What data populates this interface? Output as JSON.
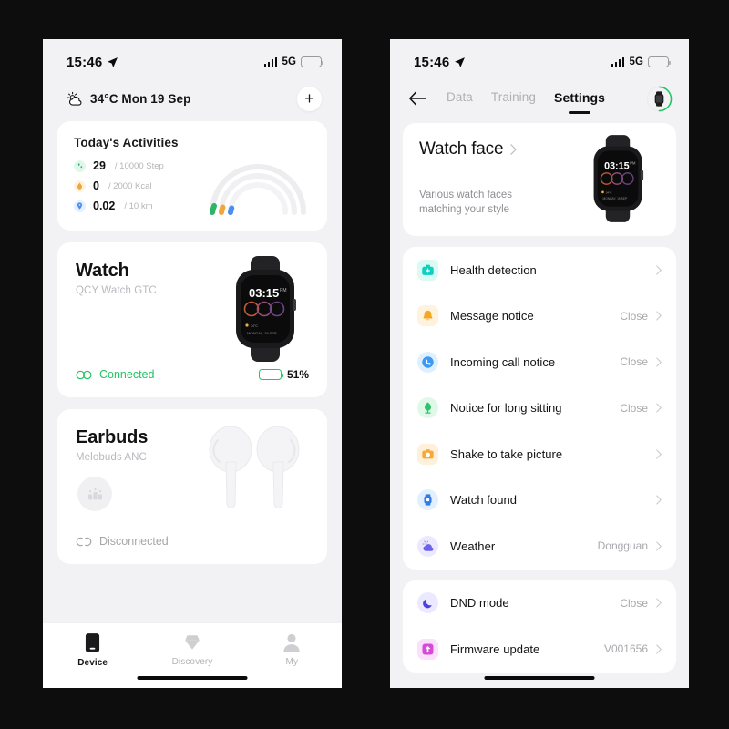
{
  "theme": {
    "background": "#0d0d0d",
    "phone_bg": "#f2f2f4",
    "card_bg": "#ffffff",
    "accent_green": "#22c563",
    "muted": "#b4b4b8"
  },
  "left_phone": {
    "status_bar": {
      "time": "15:46",
      "location_icon": "location-arrow-icon",
      "signal_icon": "signal-bars-icon",
      "network": "5G",
      "battery_icon": "battery-icon"
    },
    "weather": {
      "icon": "sun-cloud-icon",
      "text": "34°C Mon 19 Sep",
      "add_button": "+"
    },
    "activities": {
      "title": "Today's Activities",
      "rows": [
        {
          "icon": "steps-icon",
          "value": "29",
          "goal": "/ 10000 Step"
        },
        {
          "icon": "flame-icon",
          "value": "0",
          "goal": "/ 2000 Kcal"
        },
        {
          "icon": "location-pin-icon",
          "value": "0.02",
          "goal": "/ 10 km"
        }
      ],
      "arc_colors": [
        "#2db566",
        "#f0a63c",
        "#4a8ef0"
      ]
    },
    "watch_card": {
      "name": "Watch",
      "model": "QCY Watch GTC",
      "status": "Connected",
      "status_icon": "link-connected-icon",
      "battery": "51%",
      "battery_level": 51,
      "device_image": "smartwatch-image",
      "watch_screen_time": "03:15"
    },
    "earbuds_card": {
      "name": "Earbuds",
      "model": "Melobuds ANC",
      "status": "Disconnected",
      "status_icon": "link-broken-icon",
      "badge_icon": "earbuds-case-icon",
      "device_image": "earbuds-image"
    },
    "tabbar": [
      {
        "icon": "device-icon",
        "label": "Device",
        "active": true
      },
      {
        "icon": "diamond-icon",
        "label": "Discovery",
        "active": false
      },
      {
        "icon": "person-icon",
        "label": "My",
        "active": false
      }
    ]
  },
  "right_phone": {
    "status_bar": {
      "time": "15:46",
      "location_icon": "location-arrow-icon",
      "signal_icon": "signal-bars-icon",
      "network": "5G",
      "battery_icon": "battery-icon"
    },
    "nav": {
      "back_icon": "back-arrow-icon",
      "tabs": [
        {
          "label": "Data",
          "selected": false
        },
        {
          "label": "Training",
          "selected": false
        },
        {
          "label": "Settings",
          "selected": true
        }
      ],
      "avatar": "watch-avatar-icon"
    },
    "watch_face": {
      "title": "Watch face",
      "chevron": "chevron-right-icon",
      "description": "Various watch faces\nmatching your style",
      "preview_time": "03:15"
    },
    "settings_group_1": [
      {
        "icon": "health-kit-icon",
        "icon_bg": "#d9fbf3",
        "icon_color": "#10cfc0",
        "label": "Health detection",
        "value": ""
      },
      {
        "icon": "bell-icon",
        "icon_bg": "#fff3de",
        "icon_color": "#f5a623",
        "label": "Message notice",
        "value": "Close"
      },
      {
        "icon": "phone-call-icon",
        "icon_bg": "#def0ff",
        "icon_color": "#3b9af5",
        "label": "Incoming call notice",
        "value": "Close"
      },
      {
        "icon": "sitting-alert-icon",
        "icon_bg": "#dff9e9",
        "icon_color": "#2fc26b",
        "label": "Notice for long sitting",
        "value": "Close"
      },
      {
        "icon": "camera-icon",
        "icon_bg": "#fff0da",
        "icon_color": "#f7a937",
        "label": "Shake to take picture",
        "value": ""
      },
      {
        "icon": "find-watch-icon",
        "icon_bg": "#e2efff",
        "icon_color": "#2f7ce8",
        "label": "Watch found",
        "value": ""
      },
      {
        "icon": "weather-cloud-icon",
        "icon_bg": "#ece9ff",
        "icon_color": "#6b63e8",
        "label": "Weather",
        "value": "Dongguan"
      }
    ],
    "settings_group_2": [
      {
        "icon": "moon-icon",
        "icon_bg": "#ebe9ff",
        "icon_color": "#4a3fe0",
        "label": "DND mode",
        "value": "Close"
      },
      {
        "icon": "firmware-up-icon",
        "icon_bg": "#fbe0fb",
        "icon_color": "#d34bd6",
        "label": "Firmware update",
        "value": "V001656"
      }
    ]
  }
}
